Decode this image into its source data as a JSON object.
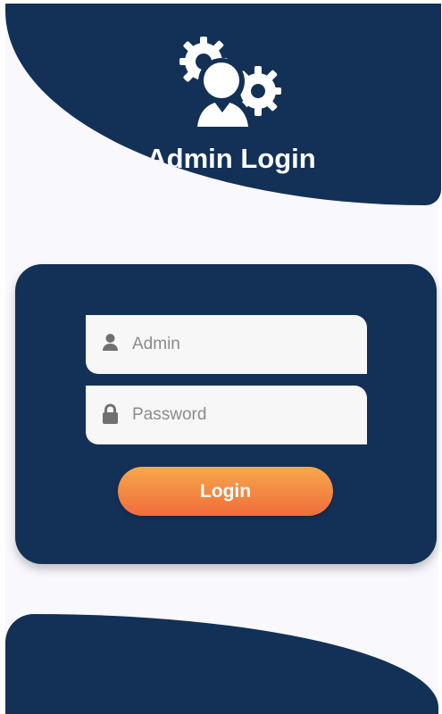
{
  "colors": {
    "navy": "#133157",
    "background": "#f8f8fd",
    "input_background": "#f7f7f7",
    "button_gradient_start": "#f6a84b",
    "button_gradient_end": "#f16c3c",
    "placeholder": "#8b8b8b"
  },
  "header": {
    "title": "Admin Login",
    "icon": "admin-gears-icon"
  },
  "login_form": {
    "username": {
      "value": "",
      "placeholder": "Admin",
      "icon": "user-icon"
    },
    "password": {
      "value": "",
      "placeholder": "Password",
      "icon": "lock-icon"
    },
    "submit_label": "Login"
  }
}
